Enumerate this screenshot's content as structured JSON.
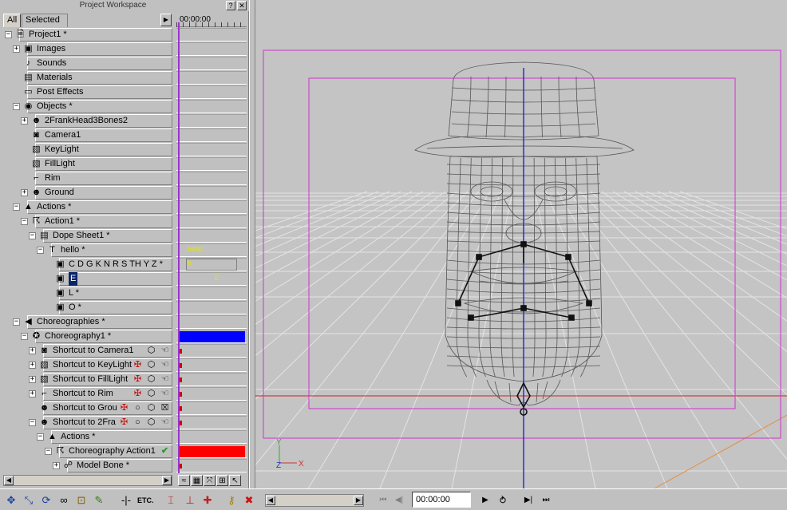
{
  "workspace": {
    "title": "Project Workspace",
    "title_buttons": [
      "?",
      "✕"
    ],
    "tabs": [
      {
        "label": "All"
      },
      {
        "label": "Selected"
      }
    ],
    "timeline_start": "00:00:00"
  },
  "tree": [
    {
      "label": "Project1 *",
      "icon": "project-icon",
      "depth": 0,
      "expander": "−"
    },
    {
      "label": "Images",
      "icon": "images-folder-icon",
      "depth": 1,
      "expander": "+"
    },
    {
      "label": "Sounds",
      "icon": "sounds-folder-icon",
      "depth": 1,
      "expander": ""
    },
    {
      "label": "Materials",
      "icon": "materials-folder-icon",
      "depth": 1,
      "expander": ""
    },
    {
      "label": "Post Effects",
      "icon": "post-effects-icon",
      "depth": 1,
      "expander": ""
    },
    {
      "label": "Objects *",
      "icon": "objects-folder-icon",
      "depth": 1,
      "expander": "−"
    },
    {
      "label": "2FrankHead3Bones2",
      "icon": "model-icon",
      "depth": 2,
      "expander": "+"
    },
    {
      "label": "Camera1",
      "icon": "camera-icon",
      "depth": 2,
      "expander": ""
    },
    {
      "label": "KeyLight",
      "icon": "light-icon",
      "depth": 2,
      "expander": ""
    },
    {
      "label": "FillLight",
      "icon": "light-icon",
      "depth": 2,
      "expander": ""
    },
    {
      "label": "Rim",
      "icon": "spotlight-icon",
      "depth": 2,
      "expander": ""
    },
    {
      "label": "Ground",
      "icon": "model-icon",
      "depth": 2,
      "expander": "+"
    },
    {
      "label": "Actions *",
      "icon": "actions-folder-icon",
      "depth": 1,
      "expander": "−"
    },
    {
      "label": "Action1 *",
      "icon": "action-icon",
      "depth": 2,
      "expander": "−"
    },
    {
      "label": "Dope Sheet1 *",
      "icon": "dope-sheet-icon",
      "depth": 3,
      "expander": "−"
    },
    {
      "label": "hello *",
      "icon": "text-icon",
      "depth": 4,
      "expander": "−"
    },
    {
      "label": "C D G K N R S TH Y Z *",
      "icon": "phoneme-icon",
      "depth": 5,
      "expander": ""
    },
    {
      "label": "E",
      "icon": "phoneme-icon",
      "depth": 5,
      "expander": "",
      "selected": true
    },
    {
      "label": "L *",
      "icon": "phoneme-icon",
      "depth": 5,
      "expander": ""
    },
    {
      "label": "O *",
      "icon": "phoneme-icon",
      "depth": 5,
      "expander": ""
    },
    {
      "label": "Choreographies *",
      "icon": "choreographies-folder-icon",
      "depth": 1,
      "expander": "−"
    },
    {
      "label": "Choreography1 *",
      "icon": "choreography-icon",
      "depth": 2,
      "expander": "−"
    },
    {
      "label": "Shortcut to Camera1",
      "icon": "camera-icon",
      "depth": 3,
      "expander": "+",
      "badges": [
        "cube-icon",
        "hand-icon"
      ]
    },
    {
      "label": "Shortcut to KeyLight",
      "icon": "light-icon",
      "depth": 3,
      "expander": "+",
      "badges": [
        "bones-icon",
        "cube-icon",
        "hand-icon"
      ]
    },
    {
      "label": "Shortcut to FillLight",
      "icon": "light-icon",
      "depth": 3,
      "expander": "+",
      "badges": [
        "bones-icon",
        "cube-icon",
        "hand-icon"
      ]
    },
    {
      "label": "Shortcut to Rim",
      "icon": "spotlight-icon",
      "depth": 3,
      "expander": "+",
      "badges": [
        "bones-icon",
        "cube-icon",
        "hand-icon"
      ]
    },
    {
      "label": "Shortcut to Grou",
      "icon": "model-icon",
      "depth": 3,
      "expander": "",
      "badges": [
        "bones-icon",
        "circle-icon",
        "cube-icon",
        "hand-crossed-icon"
      ]
    },
    {
      "label": "Shortcut to 2Fra",
      "icon": "model-icon",
      "depth": 3,
      "expander": "−",
      "badges": [
        "bones-icon",
        "circle-icon",
        "cube-icon",
        "hand-icon"
      ]
    },
    {
      "label": "Actions *",
      "icon": "actions-folder-icon",
      "depth": 4,
      "expander": "−"
    },
    {
      "label": "Choreography Action1",
      "icon": "action-icon",
      "depth": 5,
      "expander": "−",
      "check": true
    },
    {
      "label": "Model Bone *",
      "icon": "bone-icon",
      "depth": 6,
      "expander": "+"
    }
  ],
  "timeline": {
    "notes": {
      "hello_row": "hello",
      "cdg_row": "h",
      "e_row": "E"
    },
    "bar_colors": {
      "choreography": "#0000ff",
      "choreography_action": "#ff0000"
    }
  },
  "viewport": {
    "axis_labels": {
      "x": "X",
      "y": "Y",
      "z": "Z"
    },
    "colors": {
      "background": "#c4c4c4",
      "grid": "#e8e8e8",
      "wire": "#555555",
      "frame": "#cc33cc",
      "bone_axis": "#2233cc"
    }
  },
  "statusbar": {
    "time": "00:00:00",
    "buttons": [
      "move-icon",
      "scale-icon",
      "rotate-icon",
      "link-icon",
      "lock-icon",
      "pencil-icon",
      "separator-icon",
      "etc-icon",
      "bone-tool-icon",
      "bone-add-icon",
      "figure-icon",
      "key-icon",
      "delete-x-icon"
    ],
    "playback": [
      "rewind-start-icon",
      "step-back-icon",
      "play-icon",
      "loop-icon",
      "step-forward-icon",
      "fast-forward-icon"
    ]
  }
}
